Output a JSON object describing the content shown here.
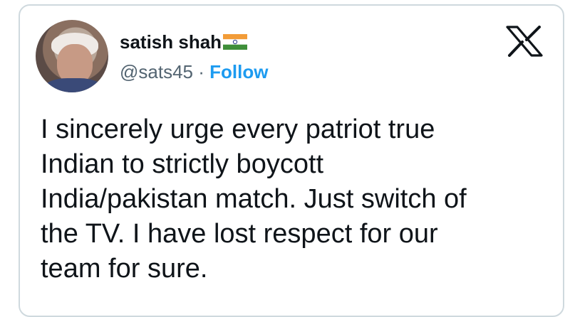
{
  "author": {
    "display_name": "satish shah",
    "flag_emoji": "india-flag",
    "handle": "@sats45",
    "separator": "·",
    "follow_label": "Follow"
  },
  "brand": {
    "logo": "x-logo-icon"
  },
  "tweet": {
    "text": "I sincerely urge every patriot true\nIndian to strictly boycott\nIndia/pakistan match. Just switch of\nthe TV. I have lost respect for our\nteam for sure."
  },
  "colors": {
    "text_primary": "#0f1419",
    "text_secondary": "#536471",
    "link": "#1d9bf0",
    "border": "#cfd9de"
  }
}
